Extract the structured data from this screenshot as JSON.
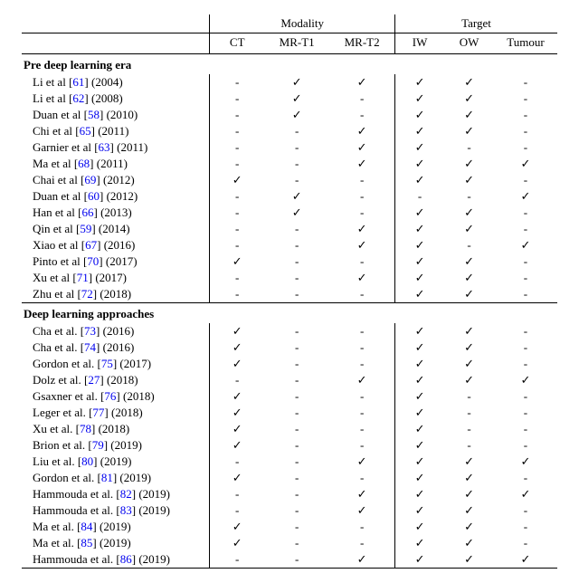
{
  "headers": {
    "modality_group": "Modality",
    "target_group": "Target",
    "cols": {
      "ct": "CT",
      "mrt1": "MR-T1",
      "mrt2": "MR-T2",
      "iw": "IW",
      "ow": "OW",
      "tumour": "Tumour"
    }
  },
  "sections": [
    {
      "title": "Pre deep learning era",
      "rows": [
        {
          "authors": "Li et al",
          "cite": "61",
          "year": "2004",
          "ct": "-",
          "mrt1": "✓",
          "mrt2": "✓",
          "iw": "✓",
          "ow": "✓",
          "tumour": "-"
        },
        {
          "authors": "Li et al",
          "cite": "62",
          "year": "2008",
          "ct": "-",
          "mrt1": "✓",
          "mrt2": "-",
          "iw": "✓",
          "ow": "✓",
          "tumour": "-"
        },
        {
          "authors": "Duan et al",
          "cite": "58",
          "year": "2010",
          "ct": "-",
          "mrt1": "✓",
          "mrt2": "-",
          "iw": "✓",
          "ow": "✓",
          "tumour": "-"
        },
        {
          "authors": "Chi et al",
          "cite": "65",
          "year": "2011",
          "ct": "-",
          "mrt1": "-",
          "mrt2": "✓",
          "iw": "✓",
          "ow": "✓",
          "tumour": "-"
        },
        {
          "authors": "Garnier et al",
          "cite": "63",
          "year": "2011",
          "ct": "-",
          "mrt1": "-",
          "mrt2": "✓",
          "iw": "✓",
          "ow": "-",
          "tumour": "-"
        },
        {
          "authors": "Ma et al",
          "cite": "68",
          "year": "2011",
          "ct": "-",
          "mrt1": "-",
          "mrt2": "✓",
          "iw": "✓",
          "ow": "✓",
          "tumour": "✓"
        },
        {
          "authors": "Chai et al",
          "cite": "69",
          "year": "2012",
          "ct": "✓",
          "mrt1": "-",
          "mrt2": "-",
          "iw": "✓",
          "ow": "✓",
          "tumour": "-"
        },
        {
          "authors": "Duan et al",
          "cite": "60",
          "year": "2012",
          "ct": "-",
          "mrt1": "✓",
          "mrt2": "-",
          "iw": "-",
          "ow": "-",
          "tumour": "✓"
        },
        {
          "authors": "Han et al",
          "cite": "66",
          "year": "2013",
          "ct": "-",
          "mrt1": "✓",
          "mrt2": "-",
          "iw": "✓",
          "ow": "✓",
          "tumour": "-"
        },
        {
          "authors": "Qin et al",
          "cite": "59",
          "year": "2014",
          "ct": "-",
          "mrt1": "-",
          "mrt2": "✓",
          "iw": "✓",
          "ow": "✓",
          "tumour": "-"
        },
        {
          "authors": "Xiao et al",
          "cite": "67",
          "year": "2016",
          "ct": "-",
          "mrt1": "-",
          "mrt2": "✓",
          "iw": "✓",
          "ow": "-",
          "tumour": "✓"
        },
        {
          "authors": "Pinto et al",
          "cite": "70",
          "year": "2017",
          "ct": "✓",
          "mrt1": "-",
          "mrt2": "-",
          "iw": "✓",
          "ow": "✓",
          "tumour": "-"
        },
        {
          "authors": "Xu et al",
          "cite": "71",
          "year": "2017",
          "ct": "-",
          "mrt1": "-",
          "mrt2": "✓",
          "iw": "✓",
          "ow": "✓",
          "tumour": "-"
        },
        {
          "authors": "Zhu et al",
          "cite": "72",
          "year": "2018",
          "ct": "-",
          "mrt1": "-",
          "mrt2": "-",
          "iw": "✓",
          "ow": "✓",
          "tumour": "-"
        }
      ]
    },
    {
      "title": "Deep learning approaches",
      "rows": [
        {
          "authors": "Cha et al.",
          "cite": "73",
          "year": "2016",
          "ct": "✓",
          "mrt1": "-",
          "mrt2": "-",
          "iw": "✓",
          "ow": "✓",
          "tumour": "-"
        },
        {
          "authors": "Cha et al.",
          "cite": "74",
          "year": "2016",
          "ct": "✓",
          "mrt1": "-",
          "mrt2": "-",
          "iw": "✓",
          "ow": "✓",
          "tumour": "-"
        },
        {
          "authors": "Gordon et al.",
          "cite": "75",
          "year": "2017",
          "ct": "✓",
          "mrt1": "-",
          "mrt2": "-",
          "iw": "✓",
          "ow": "✓",
          "tumour": "-"
        },
        {
          "authors": "Dolz et al.",
          "cite": "27",
          "year": "2018",
          "ct": "-",
          "mrt1": "-",
          "mrt2": "✓",
          "iw": "✓",
          "ow": "✓",
          "tumour": "✓"
        },
        {
          "authors": "Gsaxner et al.",
          "cite": "76",
          "year": "2018",
          "ct": "✓",
          "mrt1": "-",
          "mrt2": "-",
          "iw": "✓",
          "ow": "-",
          "tumour": "-"
        },
        {
          "authors": "Leger et al.",
          "cite": "77",
          "year": "2018",
          "ct": "✓",
          "mrt1": "-",
          "mrt2": "-",
          "iw": "✓",
          "ow": "-",
          "tumour": "-"
        },
        {
          "authors": "Xu et al.",
          "cite": "78",
          "year": "2018",
          "ct": "✓",
          "mrt1": "-",
          "mrt2": "-",
          "iw": "✓",
          "ow": "-",
          "tumour": "-"
        },
        {
          "authors": "Brion et al.",
          "cite": "79",
          "year": "2019",
          "ct": "✓",
          "mrt1": "-",
          "mrt2": "-",
          "iw": "✓",
          "ow": "-",
          "tumour": "-"
        },
        {
          "authors": "Liu et al.",
          "cite": "80",
          "year": "2019",
          "ct": "-",
          "mrt1": "-",
          "mrt2": "✓",
          "iw": "✓",
          "ow": "✓",
          "tumour": "✓"
        },
        {
          "authors": "Gordon et al.",
          "cite": "81",
          "year": "2019",
          "ct": "✓",
          "mrt1": "-",
          "mrt2": "-",
          "iw": "✓",
          "ow": "✓",
          "tumour": "-"
        },
        {
          "authors": "Hammouda et al.",
          "cite": "82",
          "year": "2019",
          "ct": "-",
          "mrt1": "-",
          "mrt2": "✓",
          "iw": "✓",
          "ow": "✓",
          "tumour": "✓"
        },
        {
          "authors": "Hammouda et al.",
          "cite": "83",
          "year": "2019",
          "ct": "-",
          "mrt1": "-",
          "mrt2": "✓",
          "iw": "✓",
          "ow": "✓",
          "tumour": "-"
        },
        {
          "authors": "Ma et al.",
          "cite": "84",
          "year": "2019",
          "ct": "✓",
          "mrt1": "-",
          "mrt2": "-",
          "iw": "✓",
          "ow": "✓",
          "tumour": "-"
        },
        {
          "authors": "Ma et al.",
          "cite": "85",
          "year": "2019",
          "ct": "✓",
          "mrt1": "-",
          "mrt2": "-",
          "iw": "✓",
          "ow": "✓",
          "tumour": "-"
        },
        {
          "authors": "Hammouda et al.",
          "cite": "86",
          "year": "2019",
          "ct": "-",
          "mrt1": "-",
          "mrt2": "✓",
          "iw": "✓",
          "ow": "✓",
          "tumour": "✓"
        }
      ]
    }
  ]
}
